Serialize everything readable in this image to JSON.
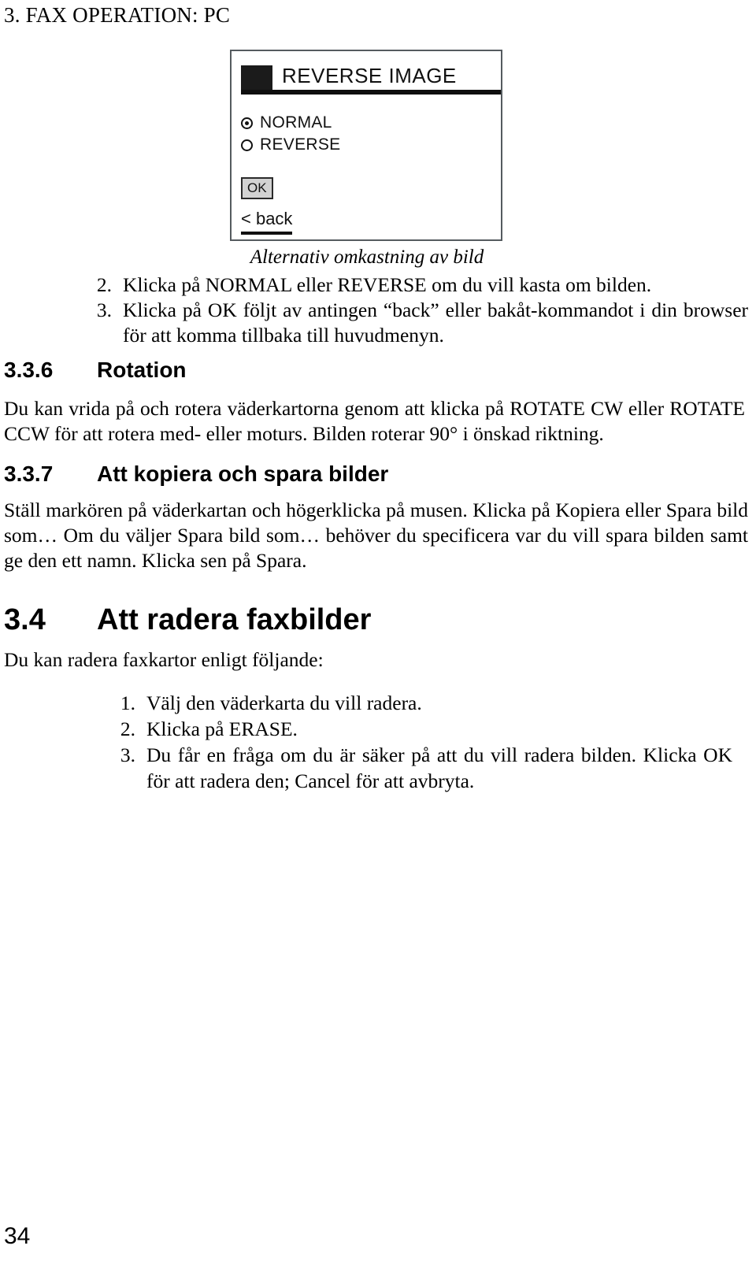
{
  "page": {
    "running_head": "3. FAX OPERATION: PC",
    "page_number": "34"
  },
  "figure": {
    "dialog": {
      "title": "REVERSE IMAGE",
      "options": [
        {
          "label": "NORMAL",
          "selected": true
        },
        {
          "label": "REVERSE",
          "selected": false
        }
      ],
      "ok_button": "OK",
      "back_link": "< back"
    },
    "caption": "Alternativ omkastning av bild"
  },
  "steps_reverse": [
    {
      "num": "2.",
      "text": "Klicka på NORMAL eller REVERSE om du vill kasta om bilden."
    },
    {
      "num": "3.",
      "text": "Klicka på OK följt av antingen “back” eller bakåt-kommandot i din browser för att komma tillbaka till huvudmenyn."
    }
  ],
  "section_336": {
    "number": "3.3.6",
    "title": "Rotation",
    "body": "Du kan vrida på och rotera väderkartorna genom att klicka på ROTATE CW eller ROTATE CCW för att rotera med- eller moturs. Bilden roterar 90° i önskad riktning."
  },
  "section_337": {
    "number": "3.3.7",
    "title": "Att kopiera och spara bilder",
    "body": "Ställ markören på väderkartan och högerklicka på musen. Klicka på Kopiera eller Spara bild som… Om du väljer Spara bild som… behöver du specificera var du vill spara bilden samt ge den ett namn. Klicka sen på Spara."
  },
  "section_34": {
    "number": "3.4",
    "title": "Att radera faxbilder",
    "intro": "Du kan radera faxkartor enligt följande:",
    "steps": [
      {
        "num": "1.",
        "text": "Välj den väderkarta du vill radera."
      },
      {
        "num": "2.",
        "text": "Klicka på ERASE."
      },
      {
        "num": "3.",
        "text": "Du får en fråga om du är säker på att du vill radera bilden. Klicka OK för att radera den; Cancel för att avbryta."
      }
    ]
  }
}
